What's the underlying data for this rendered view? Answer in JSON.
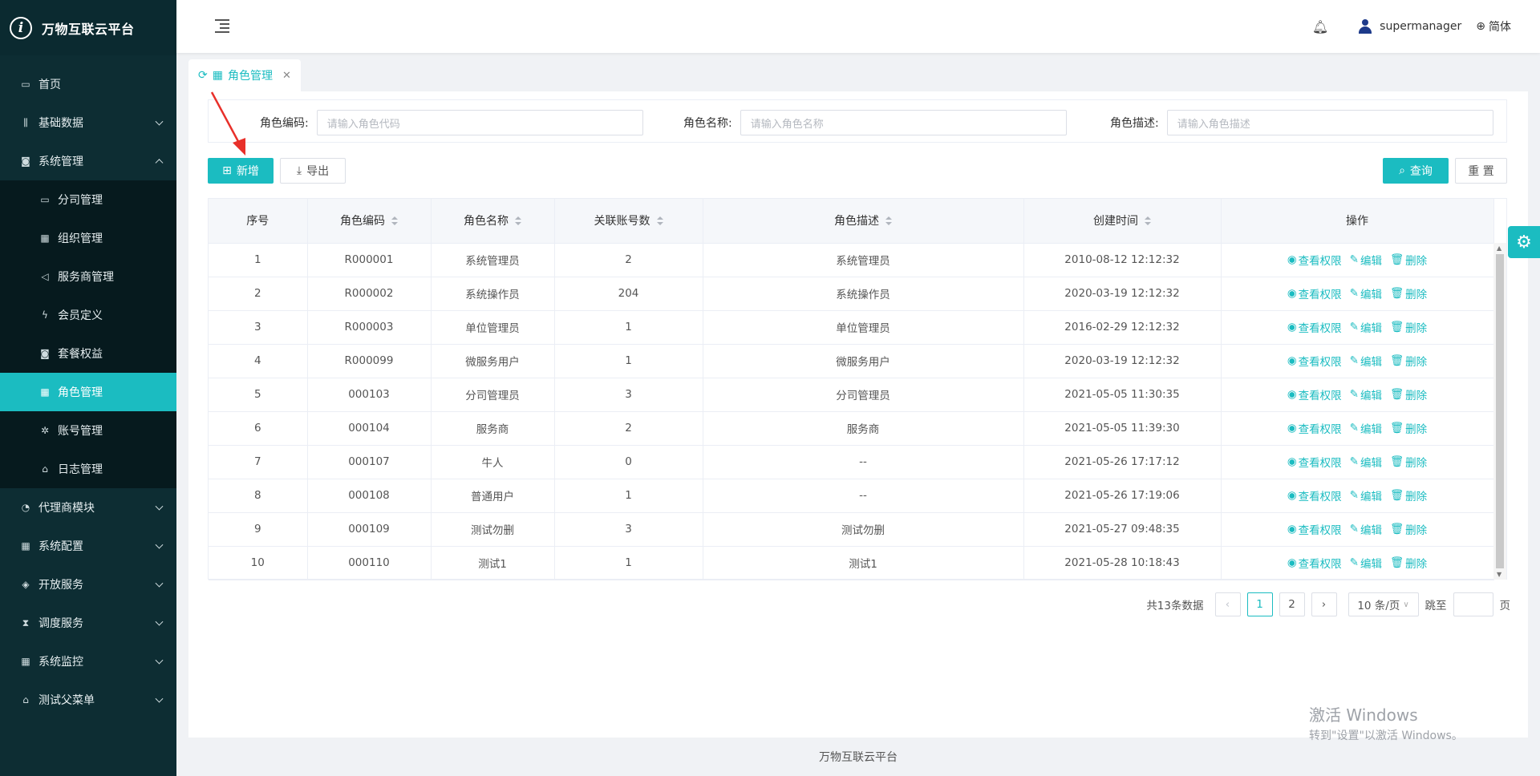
{
  "app": {
    "title": "万物互联云平台",
    "logo_letter": "i"
  },
  "sidebar": {
    "items": [
      {
        "label": "首页",
        "icon": "calendar-icon",
        "glyph": "▭",
        "expandable": false
      },
      {
        "label": "基础数据",
        "icon": "barcode-icon",
        "glyph": "⫼",
        "expandable": true
      },
      {
        "label": "系统管理",
        "icon": "camera-icon",
        "glyph": "◙",
        "expandable": true,
        "expanded": true
      },
      {
        "label": "代理商模块",
        "icon": "bell-icon",
        "glyph": "◔",
        "expandable": true
      },
      {
        "label": "系统配置",
        "icon": "grid-icon",
        "glyph": "▦",
        "expandable": true
      },
      {
        "label": "开放服务",
        "icon": "tag-icon",
        "glyph": "◈",
        "expandable": true
      },
      {
        "label": "调度服务",
        "icon": "hourglass-icon",
        "glyph": "⧗",
        "expandable": true
      },
      {
        "label": "系统监控",
        "icon": "grid-icon",
        "glyph": "▦",
        "expandable": true
      },
      {
        "label": "测试父菜单",
        "icon": "bank-icon",
        "glyph": "⌂",
        "expandable": true
      }
    ],
    "submenu": [
      {
        "label": "分司管理",
        "icon": "calendar-icon",
        "glyph": "▭"
      },
      {
        "label": "组织管理",
        "icon": "grid-icon",
        "glyph": "▦"
      },
      {
        "label": "服务商管理",
        "icon": "speaker-icon",
        "glyph": "◁"
      },
      {
        "label": "会员定义",
        "icon": "lightning-icon",
        "glyph": "ϟ"
      },
      {
        "label": "套餐权益",
        "icon": "camera-icon",
        "glyph": "◙"
      },
      {
        "label": "角色管理",
        "icon": "grid-icon",
        "glyph": "▦",
        "active": true
      },
      {
        "label": "账号管理",
        "icon": "bug-icon",
        "glyph": "✲"
      },
      {
        "label": "日志管理",
        "icon": "home-icon",
        "glyph": "⌂"
      }
    ]
  },
  "header": {
    "username": "supermanager",
    "language": "简体"
  },
  "tab": {
    "label": "角色管理"
  },
  "search": {
    "role_code_label": "角色编码:",
    "role_code_placeholder": "请输入角色代码",
    "role_name_label": "角色名称:",
    "role_name_placeholder": "请输入角色名称",
    "role_desc_label": "角色描述:",
    "role_desc_placeholder": "请输入角色描述"
  },
  "toolbar": {
    "add_label": "新增",
    "export_label": "导出",
    "query_label": "查询",
    "reset_label": "重 置"
  },
  "table": {
    "headers": [
      "序号",
      "角色编码",
      "角色名称",
      "关联账号数",
      "角色描述",
      "创建时间",
      "操作"
    ],
    "sortable": [
      false,
      true,
      true,
      true,
      true,
      true,
      false
    ],
    "ops": {
      "view": "查看权限",
      "edit": "编辑",
      "delete": "删除"
    },
    "rows": [
      [
        "1",
        "R000001",
        "系统管理员",
        "2",
        "系统管理员",
        "2010-08-12 12:12:32"
      ],
      [
        "2",
        "R000002",
        "系统操作员",
        "204",
        "系统操作员",
        "2020-03-19 12:12:32"
      ],
      [
        "3",
        "R000003",
        "单位管理员",
        "1",
        "单位管理员",
        "2016-02-29 12:12:32"
      ],
      [
        "4",
        "R000099",
        "微服务用户",
        "1",
        "微服务用户",
        "2020-03-19 12:12:32"
      ],
      [
        "5",
        "000103",
        "分司管理员",
        "3",
        "分司管理员",
        "2021-05-05 11:30:35"
      ],
      [
        "6",
        "000104",
        "服务商",
        "2",
        "服务商",
        "2021-05-05 11:39:30"
      ],
      [
        "7",
        "000107",
        "牛人",
        "0",
        "--",
        "2021-05-26 17:17:12"
      ],
      [
        "8",
        "000108",
        "普通用户",
        "1",
        "--",
        "2021-05-26 17:19:06"
      ],
      [
        "9",
        "000109",
        "测试勿删",
        "3",
        "测试勿删",
        "2021-05-27 09:48:35"
      ],
      [
        "10",
        "000110",
        "测试1",
        "1",
        "测试1",
        "2021-05-28 10:18:43"
      ]
    ]
  },
  "pagination": {
    "total_text": "共13条数据",
    "pages": [
      "1",
      "2"
    ],
    "current": "1",
    "page_size": "10 条/页",
    "jump_label": "跳至",
    "page_suffix": "页"
  },
  "footer": {
    "text": "万物互联云平台"
  },
  "watermark": {
    "line1": "激活 Windows",
    "line2": "转到\"设置\"以激活 Windows。"
  },
  "colors": {
    "accent": "#1bbcc1",
    "sidebar_bg": "#0d2d33",
    "annotation": "#e8302a"
  }
}
